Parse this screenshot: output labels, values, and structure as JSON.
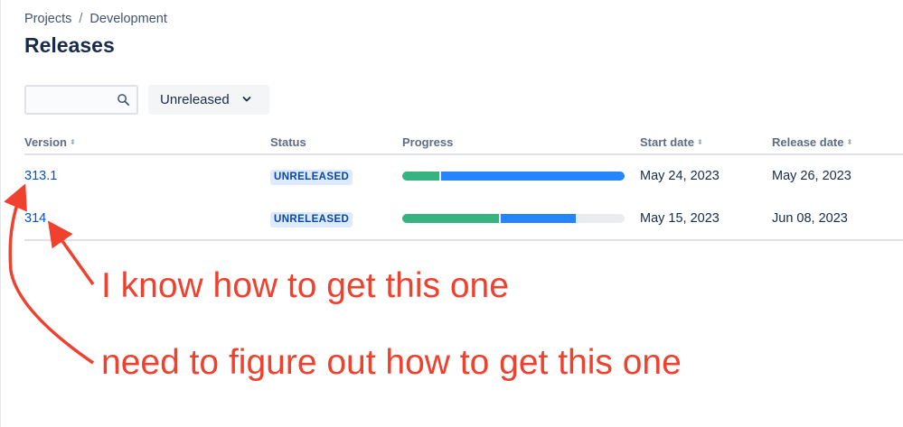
{
  "breadcrumb": {
    "items": [
      "Projects",
      "Development"
    ],
    "separator": "/"
  },
  "page": {
    "title": "Releases"
  },
  "search": {
    "value": "",
    "placeholder": "",
    "icon": "search-icon"
  },
  "filter": {
    "selected": "Unreleased",
    "icon": "chevron-down-icon"
  },
  "table": {
    "columns": {
      "version": "Version",
      "status": "Status",
      "progress": "Progress",
      "start_date": "Start date",
      "release_date": "Release date"
    },
    "sortable": [
      "version",
      "start_date",
      "release_date"
    ],
    "rows": [
      {
        "version": "313.1",
        "status": "UNRELEASED",
        "progress": {
          "done_pct": 17,
          "in_progress_pct": 83
        },
        "start_date": "May 24, 2023",
        "release_date": "May 26, 2023"
      },
      {
        "version": "314",
        "status": "UNRELEASED",
        "progress": {
          "done_pct": 44,
          "in_progress_pct": 34
        },
        "start_date": "May 15, 2023",
        "release_date": "Jun 08, 2023"
      }
    ]
  },
  "annotations": {
    "note1": "I know how to get this one",
    "note2": "need to figure out how to get this one",
    "color": "#f0402e"
  },
  "colors": {
    "link": "#0052cc",
    "lozenge_bg": "#deebff",
    "lozenge_text": "#0747a6",
    "progress_done": "#36b37e",
    "progress_in_progress": "#2684ff",
    "progress_todo": "#ebecf0"
  }
}
